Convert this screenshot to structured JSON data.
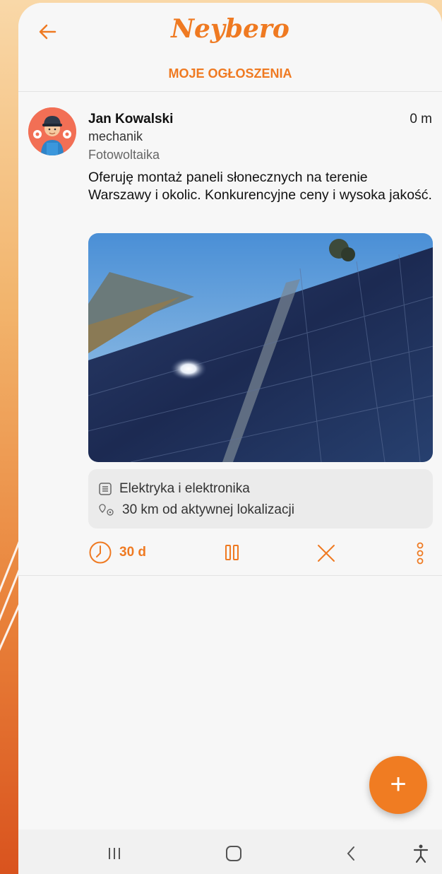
{
  "app": {
    "logo_text": "Neybero",
    "page_title": "MOJE OGŁOSZENIA",
    "accent_color": "#ef7a22"
  },
  "post": {
    "author": "Jan Kowalski",
    "time": "0 m",
    "role": "mechanik",
    "category": "Fotowoltaika",
    "description": "Oferuję montaż paneli słonecznych na terenie Warszawy i okolic. Konkurencyjne ceny i wysoka jakość.",
    "image_icon": "solar-panels-photo",
    "info": {
      "section": "Elektryka i elektronika",
      "distance": "30 km od aktywnej lokalizacji"
    },
    "timer": "30 d"
  },
  "fab": {
    "label": "+"
  },
  "icons": {
    "back": "arrow-left-icon",
    "section": "list-icon",
    "location": "location-pin-icon",
    "timer": "clock-icon",
    "pause": "pause-icon",
    "close": "close-icon",
    "more": "more-vertical-icon"
  }
}
